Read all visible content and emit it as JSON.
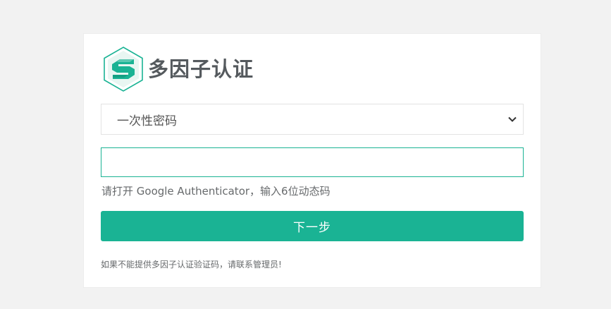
{
  "header": {
    "title": "多因子认证",
    "logo_icon": "hexagon-s-logo-icon"
  },
  "auth_method_select": {
    "selected": "一次性密码",
    "options": [
      "一次性密码"
    ]
  },
  "otp_input": {
    "value": "",
    "placeholder": ""
  },
  "hint_text": "请打开 Google Authenticator，输入6位动态码",
  "next_button": {
    "label": "下一步"
  },
  "footer_note": "如果不能提供多因子认证验证码，请联系管理员!",
  "colors": {
    "accent": "#1ab394",
    "background": "#f2f2f2",
    "title_text": "#555a5e"
  }
}
